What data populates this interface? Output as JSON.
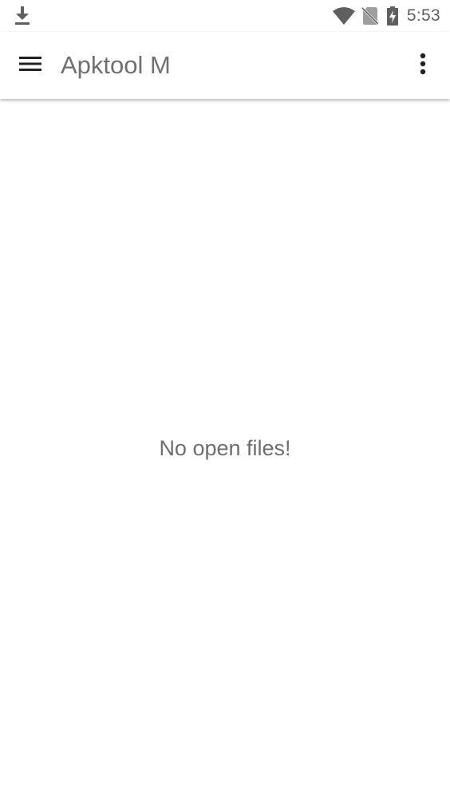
{
  "status_bar": {
    "time": "5:53",
    "icons": [
      "download-icon",
      "wifi-icon",
      "no-sim-icon",
      "battery-charging-icon"
    ]
  },
  "toolbar": {
    "title": "Apktool M",
    "menu_icon": "hamburger-menu-icon",
    "overflow_icon": "more-vert-icon"
  },
  "content": {
    "empty_message": "No open files!"
  },
  "colors": {
    "background": "#ffffff",
    "icon_dark": "#222222",
    "status_icon": "#5f5f5f",
    "title_text": "#707070",
    "empty_text": "#6e6e6e"
  }
}
